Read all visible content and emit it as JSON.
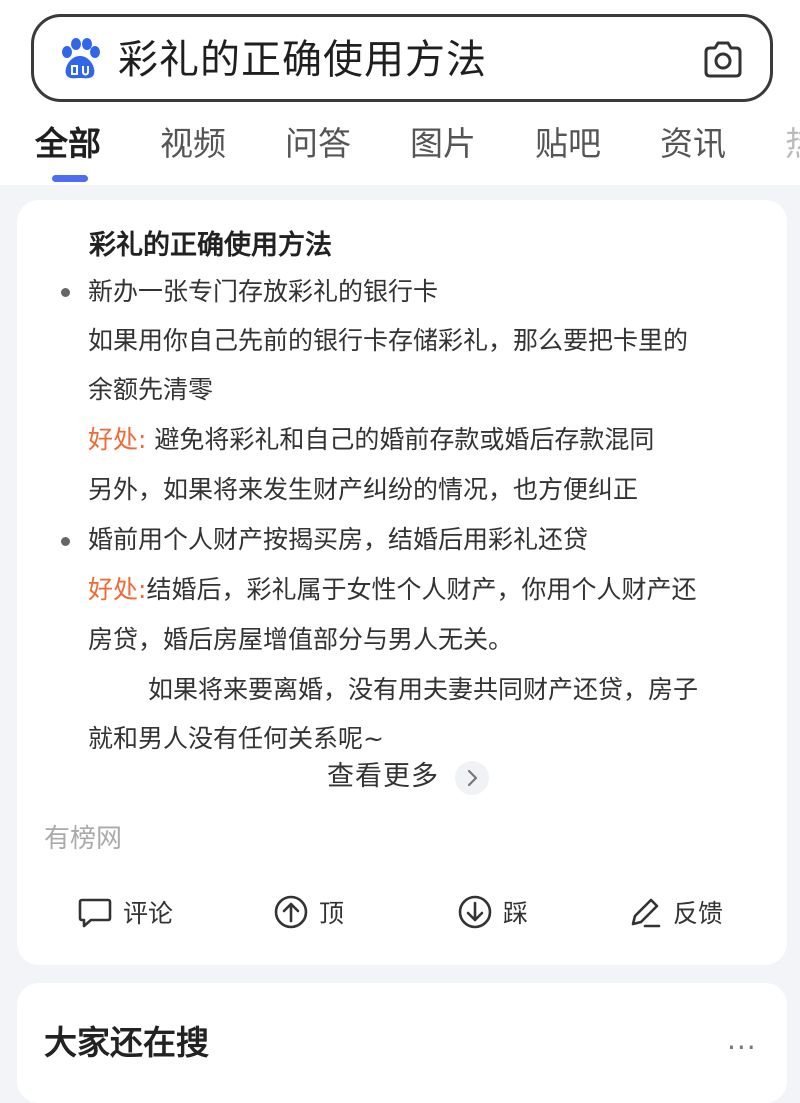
{
  "search": {
    "query": "彩礼的正确使用方法"
  },
  "tabs": [
    {
      "label": "全部",
      "active": true
    },
    {
      "label": "视频"
    },
    {
      "label": "问答"
    },
    {
      "label": "图片"
    },
    {
      "label": "贴吧"
    },
    {
      "label": "资讯"
    },
    {
      "label": "热"
    }
  ],
  "result": {
    "title": "彩礼的正确使用方法",
    "lines": [
      "新办一张专门存放彩礼的银行卡",
      "如果用你自己先前的银行卡存储彩礼，那么要把卡里的",
      "余额先清零",
      "避免将彩礼和自己的婚前存款或婚后存款混同",
      "另外，如果将来发生财产纠纷的情况，也方便纠正",
      "婚前用个人财产按揭买房，结婚后用彩礼还贷",
      "结婚后，彩礼属于女性个人财产，你用个人财产还",
      "房贷，婚后房屋增值部分与男人无关。",
      "如果将来要离婚，没有用夫妻共同财产还贷，房子",
      "就和男人没有任何关系呢~"
    ],
    "benefit_label_1": "好处: ",
    "benefit_label_2": "好处:",
    "view_more": "查看更多",
    "source": "有榜网",
    "actions": {
      "comment": "评论",
      "up": "顶",
      "down": "踩",
      "feedback": "反馈"
    }
  },
  "related": {
    "title": "大家还在搜",
    "more": "···"
  },
  "colors": {
    "accent": "#4e6ef2",
    "highlight": "#f06a35"
  }
}
